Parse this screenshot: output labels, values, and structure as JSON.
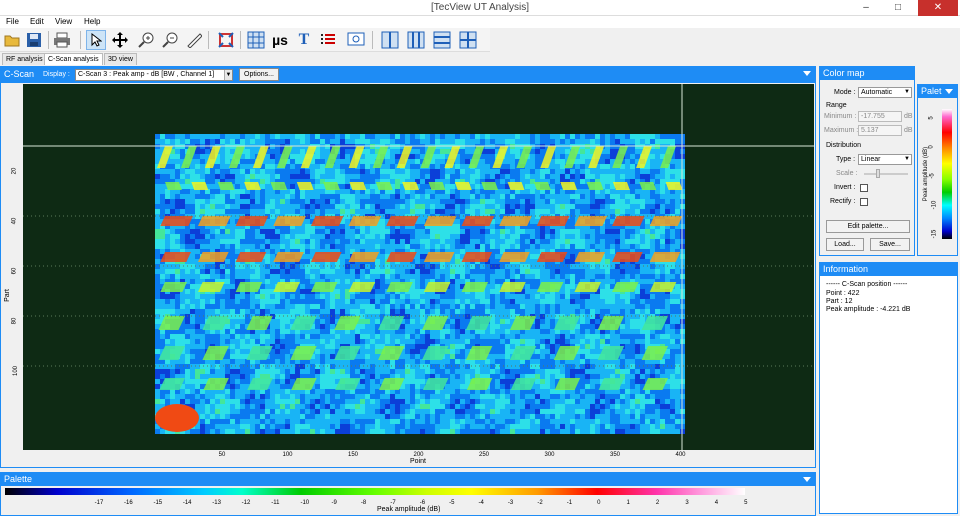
{
  "window": {
    "title": "[TecView UT Analysis]",
    "minimize": "–",
    "maximize": "□",
    "close": "✕"
  },
  "menu": [
    "File",
    "Edit",
    "View",
    "Help"
  ],
  "toolbar": {
    "icons": [
      "folder-open-icon",
      "save-icon",
      "print-icon",
      "pointer-icon",
      "move-icon",
      "zoom-in-icon",
      "zoom-out-icon",
      "ruler-icon",
      "zoom-fit-icon",
      "grid-icon",
      "microseconds-icon",
      "text-icon",
      "list-icon",
      "magnifier-icon",
      "layout-1-icon",
      "layout-2-icon",
      "layout-3-icon",
      "layout-4-icon"
    ],
    "us_label": "µs",
    "t_label": "T"
  },
  "tabs": [
    "RF analysis",
    "C-Scan analysis",
    "3D view"
  ],
  "cscan": {
    "title": "C-Scan",
    "display_label": "Display :",
    "display_value": "C-Scan 3 : Peak amp - dB [BW , Channel 1]",
    "options_label": "Options...",
    "x_axis_label": "Point",
    "y_axis_label": "Part",
    "x_ticks": [
      "50",
      "100",
      "150",
      "200",
      "250",
      "300",
      "350",
      "400"
    ],
    "y_ticks": [
      "20",
      "40",
      "60",
      "80",
      "100"
    ]
  },
  "colormap": {
    "title": "Color map",
    "mode_label": "Mode :",
    "mode_value": "Automatic",
    "range_label": "Range",
    "minimum_label": "Minimum :",
    "minimum_value": "-17.755",
    "minimum_unit": "dB",
    "maximum_label": "Maximum :",
    "maximum_value": "5.137",
    "maximum_unit": "dB",
    "distribution_label": "Distribution",
    "type_label": "Type :",
    "type_value": "Linear",
    "scale_label": "Scale :",
    "invert_label": "Invert :",
    "rectify_label": "Rectify :",
    "edit_palette": "Edit palette...",
    "load": "Load...",
    "save": "Save..."
  },
  "palet": {
    "title": "Palet",
    "axis_label": "Peak amplitude (dB)",
    "ticks": [
      "5",
      "0",
      "-5",
      "-10",
      "-15"
    ]
  },
  "information": {
    "title": "Information",
    "lines": [
      "------ C-Scan position ------",
      "Point : 422",
      "Part : 12",
      "Peak amplitude : -4.221 dB"
    ]
  },
  "palette_bar": {
    "title": "Palette",
    "axis_label": "Peak amplitude (dB)",
    "ticks": [
      "-17",
      "-16",
      "-15",
      "-14",
      "-13",
      "-12",
      "-11",
      "-10",
      "-9",
      "-8",
      "-7",
      "-6",
      "-5",
      "-4",
      "-3",
      "-2",
      "-1",
      "0",
      "1",
      "2",
      "3",
      "4",
      "5"
    ]
  }
}
